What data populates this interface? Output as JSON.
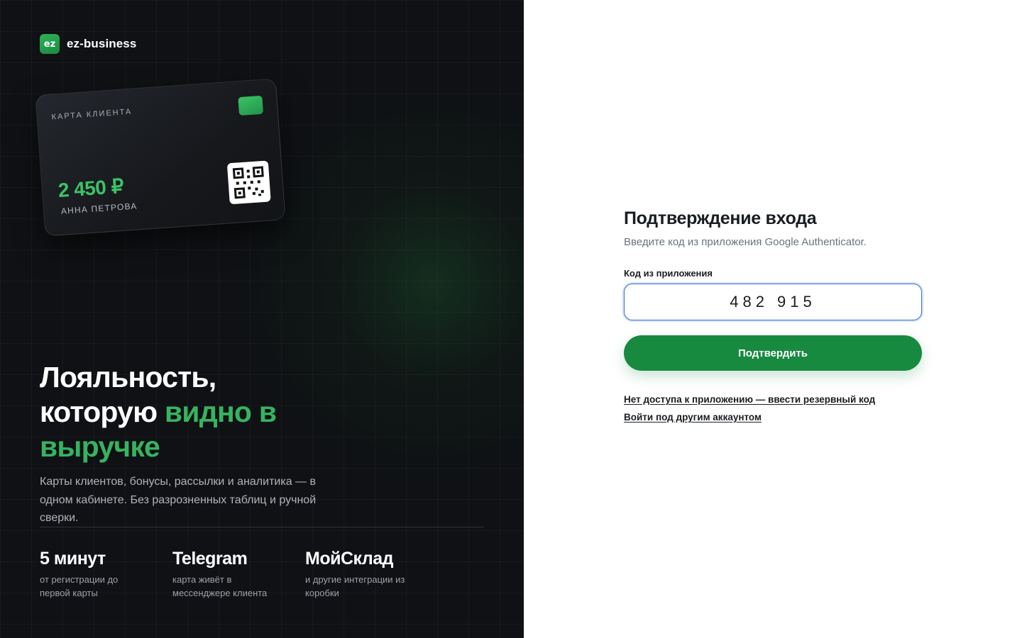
{
  "brand": {
    "logo_text": "ez",
    "name": "ez-business"
  },
  "card": {
    "label": "КАРТА КЛИЕНТА",
    "amount": "2 450 ₽",
    "holder": "АННА ПЕТРОВА",
    "chip_icon": "card-chip-icon",
    "qr_icon": "qr-code-icon"
  },
  "hero": {
    "line1": "Лояльность,",
    "line2_plain": "которую ",
    "line2_accent": "видно в",
    "line3_accent": "выручке"
  },
  "description": "Карты клиентов, бонусы, рассылки и аналитика — в одном кабинете. Без разрозненных таблиц и ручной сверки.",
  "stats": [
    {
      "title": "5 минут",
      "subtitle": "от регистрации до первой карты"
    },
    {
      "title": "Telegram",
      "subtitle": "карта живёт в мессенджере клиента"
    },
    {
      "title": "МойСклад",
      "subtitle": "и другие интеграции из коробки"
    }
  ],
  "form": {
    "title": "Подтверждение входа",
    "subtitle": "Введите код из приложения Google Authenticator.",
    "code_label": "Код из приложения",
    "code_value": "482 915",
    "submit_label": "Подтвердить",
    "backup_link": "Нет доступа к приложению — ввести резервный код",
    "other_account_link": "Войти под другим аккаунтом"
  },
  "colors": {
    "accent_green": "#37b360",
    "button_green": "#178a40",
    "focus_blue": "#3b73d6",
    "dark_bg": "#0f1114"
  }
}
